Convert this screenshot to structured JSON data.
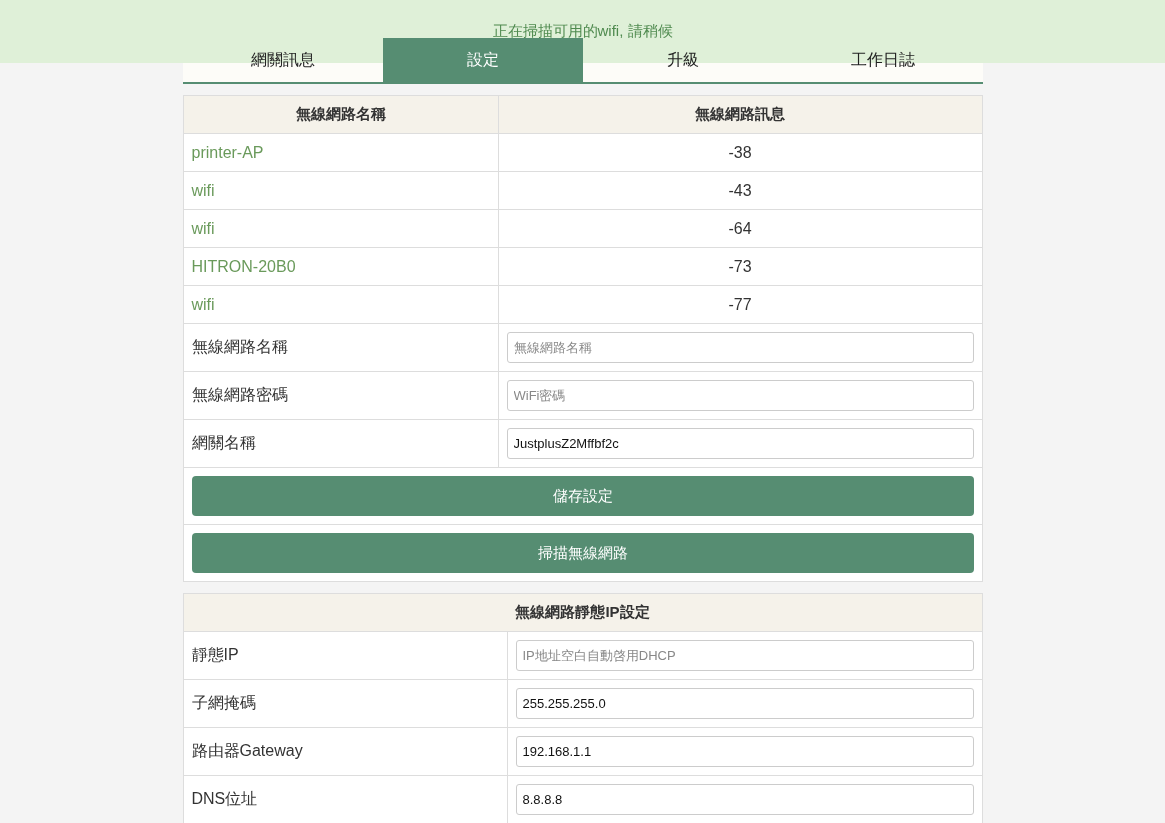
{
  "notice": {
    "text": "正在掃描可用的wifi, 請稍候"
  },
  "tabs": [
    {
      "label": "網關訊息",
      "selected": false
    },
    {
      "label": "設定",
      "selected": true
    },
    {
      "label": "升級",
      "selected": false
    },
    {
      "label": "工作日誌",
      "selected": false
    }
  ],
  "wifi_table": {
    "columns": [
      "無線網路名稱",
      "無線網路訊息"
    ],
    "rows": [
      {
        "ssid": "printer-AP",
        "signal": "-38"
      },
      {
        "ssid": "wifi",
        "signal": "-43"
      },
      {
        "ssid": "wifi",
        "signal": "-64"
      },
      {
        "ssid": "HITRON-20B0",
        "signal": "-73"
      },
      {
        "ssid": "wifi",
        "signal": "-77"
      }
    ],
    "fields": [
      {
        "label": "無線網路名稱",
        "placeholder": "無線網路名稱"
      },
      {
        "label": "無線網路密碼",
        "placeholder": "WiFi密碼"
      },
      {
        "label": "網關名稱",
        "value": "JustplusZ2Mffbf2c"
      }
    ],
    "buttons": [
      "儲存設定",
      "掃描無線網路"
    ]
  },
  "static_ip": {
    "title": "無線網路靜態IP設定",
    "fields": [
      {
        "label": "靜態IP",
        "placeholder": "IP地址空白自動啓用DHCP"
      },
      {
        "label": "子網掩碼",
        "value": "255.255.255.0"
      },
      {
        "label": "路由器Gateway",
        "value": "192.168.1.1"
      },
      {
        "label": "DNS位址",
        "value": "8.8.8.8"
      }
    ]
  }
}
